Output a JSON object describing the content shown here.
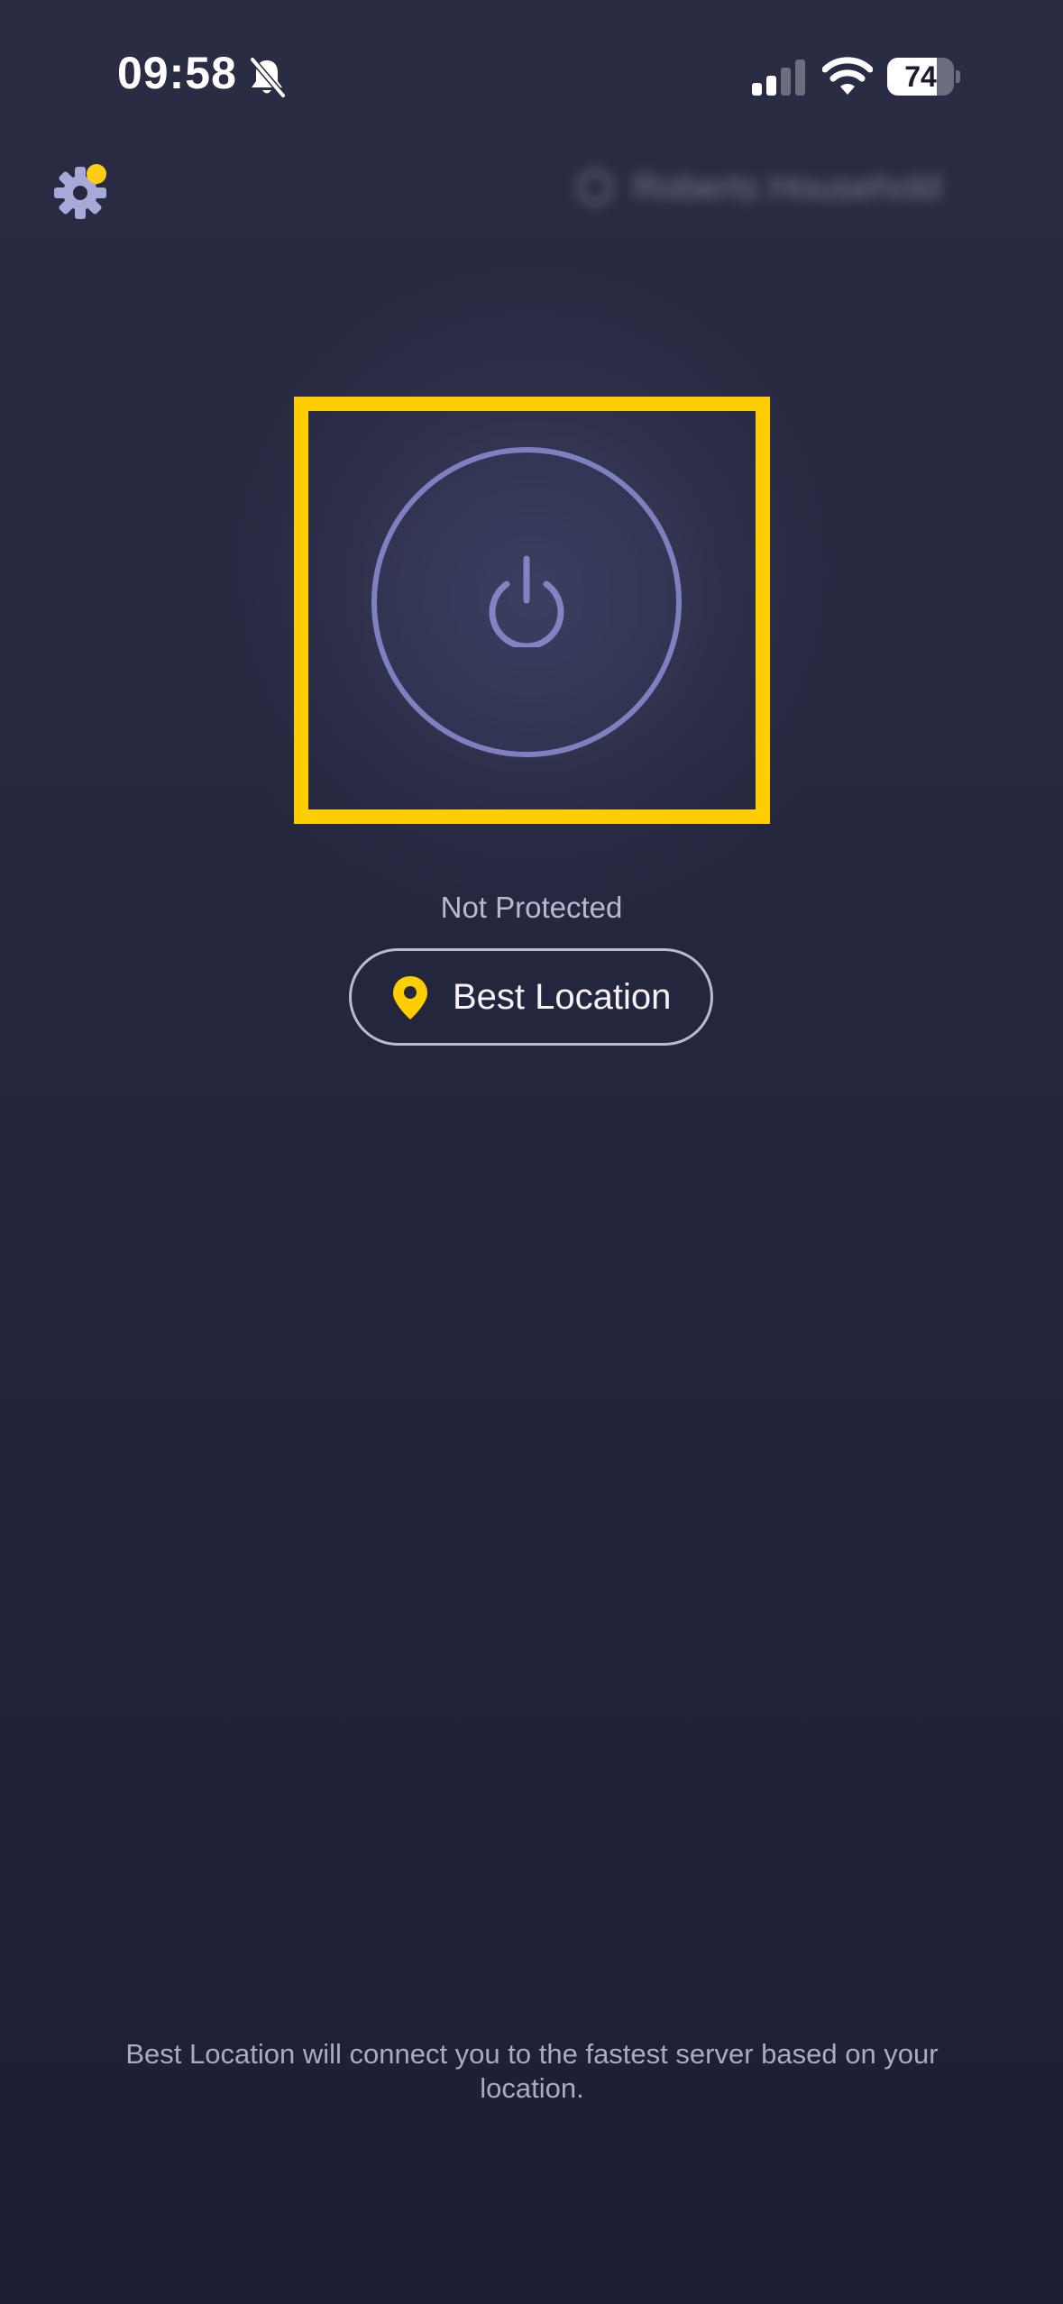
{
  "status_bar": {
    "time": "09:58",
    "silent_icon": "bell-slash-icon",
    "signal_icon": "cellular-signal-icon",
    "wifi_icon": "wifi-icon",
    "battery_percent": 74,
    "battery_label": "74"
  },
  "header": {
    "settings_icon": "gear-icon",
    "settings_badge_color": "#ffce14",
    "account_label": "Roberts Household",
    "account_icon": "user-icon"
  },
  "main": {
    "power_icon": "power-icon",
    "status_text": "Not Protected",
    "location_button": {
      "icon": "location-pin-icon",
      "label": "Best Location"
    },
    "footer_note": "Best Location will connect you to the fastest server based on your location."
  },
  "colors": {
    "background_top": "#2a2c44",
    "background_bottom": "#1c1e34",
    "accent_yellow": "#ffce00",
    "power_ring": "#7e80c0"
  }
}
